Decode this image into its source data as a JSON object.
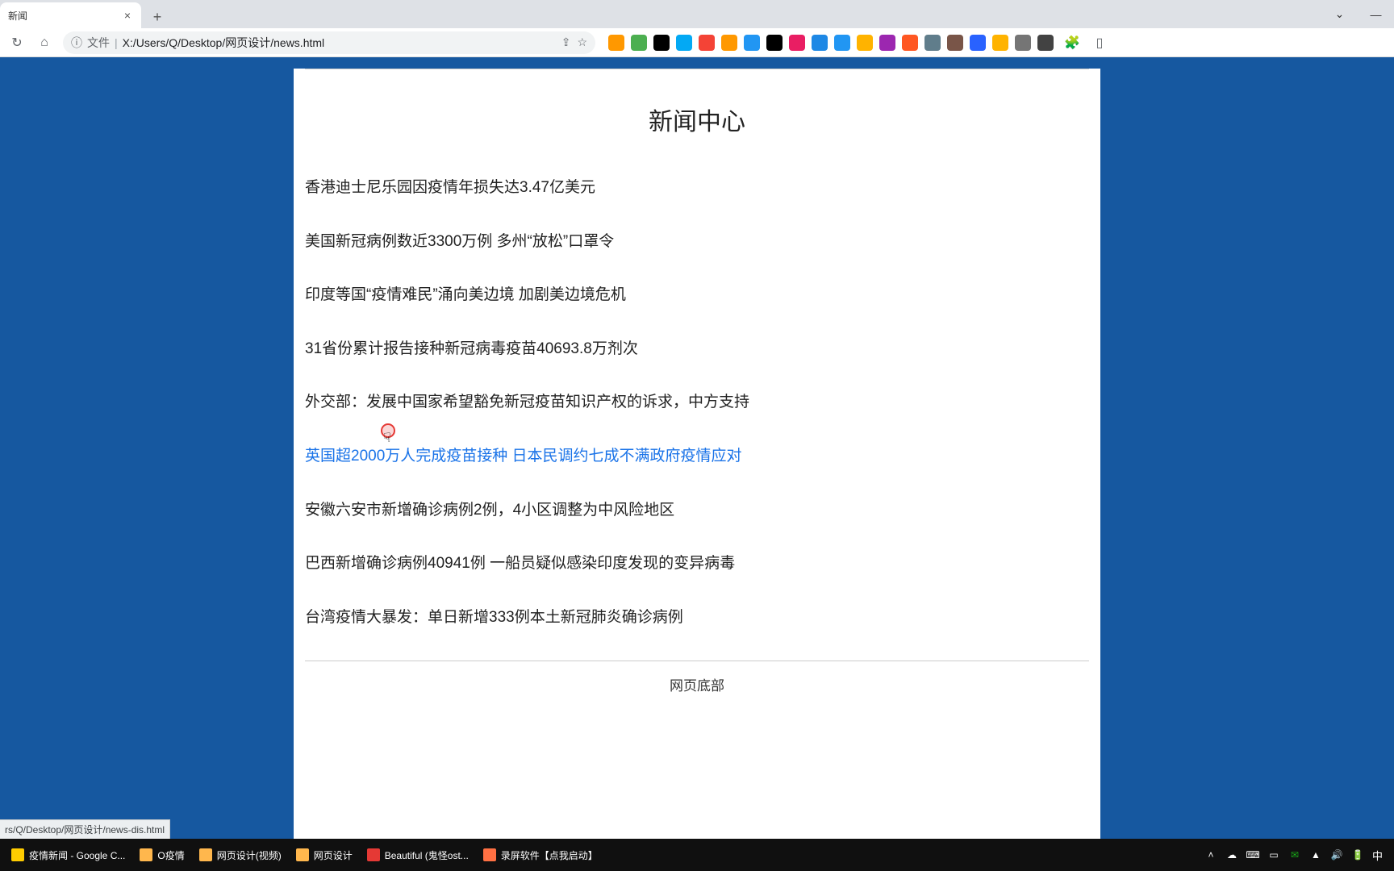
{
  "browser": {
    "tab_title": "新闻",
    "address_prefix_label": "文件",
    "url": "X:/Users/Q/Desktop/网页设计/news.html",
    "status_hover": "rs/Q/Desktop/网页设计/news-dis.html"
  },
  "page": {
    "heading": "新闻中心",
    "footer": "网页底部",
    "news": [
      {
        "text": "香港迪士尼乐园因疫情年损失达3.47亿美元",
        "hover": false
      },
      {
        "text": "美国新冠病例数近3300万例 多州“放松”口罩令",
        "hover": false
      },
      {
        "text": "印度等国“疫情难民”涌向美边境 加剧美边境危机",
        "hover": false
      },
      {
        "text": "31省份累计报告接种新冠病毒疫苗40693.8万剂次",
        "hover": false
      },
      {
        "text": "外交部：发展中国家希望豁免新冠疫苗知识产权的诉求，中方支持",
        "hover": false
      },
      {
        "text": "英国超2000万人完成疫苗接种 日本民调约七成不满政府疫情应对",
        "hover": true
      },
      {
        "text": "安徽六安市新增确诊病例2例，4小区调整为中风险地区",
        "hover": false
      },
      {
        "text": "巴西新增确诊病例40941例 一船员疑似感染印度发现的变异病毒",
        "hover": false
      },
      {
        "text": "台湾疫情大暴发：单日新增333例本土新冠肺炎确诊病例",
        "hover": false
      }
    ]
  },
  "taskbar": {
    "items": [
      {
        "label": "疫情新闻 - Google C...",
        "color": "#ffcc00"
      },
      {
        "label": "O疫情",
        "color": "#ffb74d"
      },
      {
        "label": "网页设计(视频)",
        "color": "#ffb74d"
      },
      {
        "label": "网页设计",
        "color": "#ffb74d"
      },
      {
        "label": "Beautiful (鬼怪ost...",
        "color": "#e53935"
      },
      {
        "label": "录屏软件【点我启动】",
        "color": "#ff7043"
      }
    ],
    "ime": "中"
  },
  "extensions": [
    {
      "bg": "#ff9800"
    },
    {
      "bg": "#4caf50"
    },
    {
      "bg": "#000000"
    },
    {
      "bg": "#03a9f4"
    },
    {
      "bg": "#f44336"
    },
    {
      "bg": "#ff9800"
    },
    {
      "bg": "#2196f3"
    },
    {
      "bg": "#000000"
    },
    {
      "bg": "#e91e63"
    },
    {
      "bg": "#1e88e5"
    },
    {
      "bg": "#2196f3"
    },
    {
      "bg": "#ffb300"
    },
    {
      "bg": "#9c27b0"
    },
    {
      "bg": "#ff5722"
    },
    {
      "bg": "#607d8b"
    },
    {
      "bg": "#795548"
    },
    {
      "bg": "#2962ff"
    },
    {
      "bg": "#ffb300"
    },
    {
      "bg": "#757575"
    },
    {
      "bg": "#424242"
    }
  ]
}
